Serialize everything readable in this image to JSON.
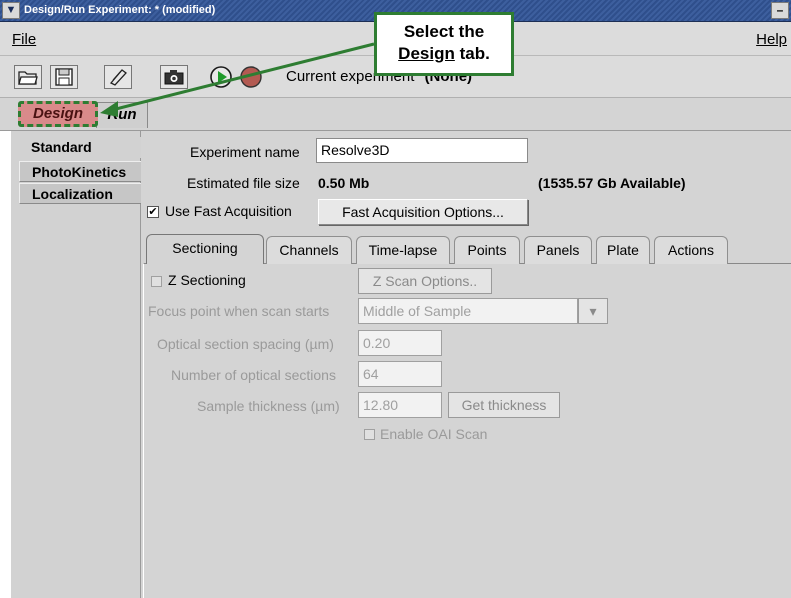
{
  "window": {
    "title": "Design/Run Experiment:  * (modified)",
    "menu_button": "▼",
    "minimize_button": "–"
  },
  "menubar": {
    "file": "File",
    "help": "Help"
  },
  "toolbar": {
    "current_experiment_label": "Current experiment",
    "current_experiment_value": "(None)",
    "icons": [
      "open-folder-icon",
      "save-icon",
      "edit-icon",
      "camera-icon",
      "play-icon",
      "stop-icon"
    ]
  },
  "outer_tabs": {
    "design": "Design",
    "run": "Run"
  },
  "left_panel": {
    "items": [
      "Standard",
      "PhotoKinetics",
      "Localization"
    ]
  },
  "form": {
    "experiment_name_label": "Experiment name",
    "experiment_name_value": "Resolve3D",
    "file_size_label": "Estimated file size",
    "file_size_value": "0.50 Mb",
    "available": "(1535.57 Gb Available)",
    "fast_acq_checked": "✔",
    "fast_acq_label": "Use Fast Acquisition",
    "fast_acq_button": "Fast Acquisition Options..."
  },
  "inner_tabs": [
    "Sectioning",
    "Channels",
    "Time-lapse",
    "Points",
    "Panels",
    "Plate",
    "Actions"
  ],
  "sectioning": {
    "z_sectioning_label": "Z Sectioning",
    "z_scan_button": "Z Scan Options..",
    "focus_label": "Focus point when scan starts",
    "focus_value": "Middle of Sample",
    "spacing_label": "Optical section spacing (µm)",
    "spacing_value": "0.20",
    "num_sections_label": "Number of optical sections",
    "num_sections_value": "64",
    "thickness_label": "Sample thickness (µm)",
    "thickness_value": "12.80",
    "get_thickness_button": "Get thickness",
    "oai_label": "Enable OAI Scan"
  },
  "callout": {
    "line1": "Select the",
    "word": "Design",
    "rest": " tab."
  },
  "colors": {
    "title_bg": "#3d5f9e",
    "design_tab": "#d98a8a",
    "callout_border": "#2e7d32"
  }
}
